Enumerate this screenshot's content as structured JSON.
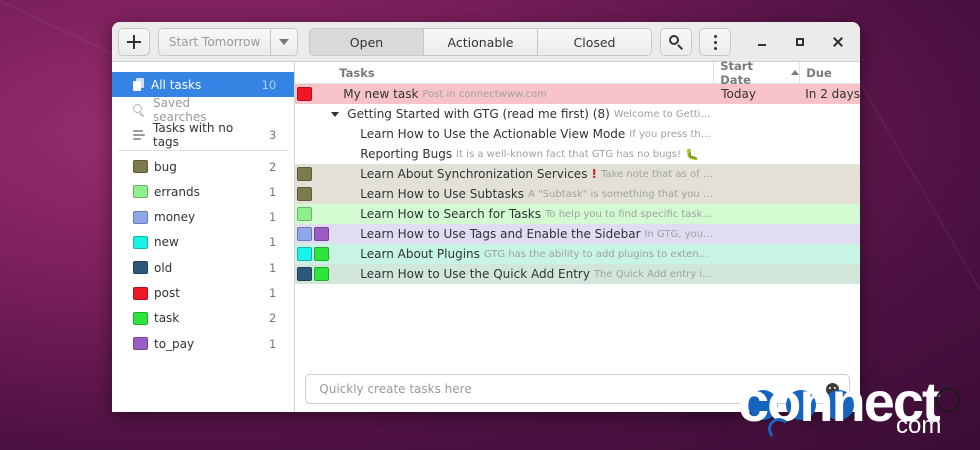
{
  "colors": {
    "accent": "#3584e4",
    "headerbar": "#ebebeb"
  },
  "header": {
    "add_icon": "plus-icon",
    "start_combo": {
      "placeholder": "Start Tomorrow"
    },
    "views": [
      {
        "label": "Open",
        "active": true
      },
      {
        "label": "Actionable",
        "active": false
      },
      {
        "label": "Closed",
        "active": false
      }
    ],
    "search_icon": "search-icon",
    "menu_icon": "kebab-menu-icon"
  },
  "sidebar": {
    "special": [
      {
        "label": "All tasks",
        "count": "10",
        "icon": "all-tasks-icon",
        "selected": true
      },
      {
        "label": "Saved searches",
        "count": "",
        "icon": "search-icon",
        "selected": false
      },
      {
        "label": "Tasks with no tags",
        "count": "3",
        "icon": "no-tags-icon",
        "selected": false
      }
    ],
    "tags": [
      {
        "label": "bug",
        "count": "2",
        "color": "#7b7b4d"
      },
      {
        "label": "errands",
        "count": "1",
        "color": "#8ef08c"
      },
      {
        "label": "money",
        "count": "1",
        "color": "#8fa6e8"
      },
      {
        "label": "new",
        "count": "1",
        "color": "#19f3e6"
      },
      {
        "label": "old",
        "count": "1",
        "color": "#2b587b"
      },
      {
        "label": "post",
        "count": "1",
        "color": "#f01626"
      },
      {
        "label": "task",
        "count": "2",
        "color": "#2ee53d"
      },
      {
        "label": "to_pay",
        "count": "1",
        "color": "#9c5cc6"
      }
    ]
  },
  "columns": {
    "tasks": "Tasks",
    "start": "Start Date",
    "due": "Due"
  },
  "tasks": [
    {
      "title": "My new task",
      "excerpt": "Post in connectwww.com",
      "start": "Today",
      "due": "In 2 days",
      "indent": 1,
      "bg": "#f7c3c8",
      "swatches": [
        "#f01626"
      ]
    },
    {
      "title": "Getting Started with GTG (read me first) (8)",
      "excerpt": "Welcome to Getting Thin...",
      "start": "",
      "due": "",
      "indent": 0,
      "bg": "#ffffff",
      "swatches": [],
      "expander": true
    },
    {
      "title": "Learn How to Use the Actionable View Mode",
      "excerpt": "If you press the \"Acti...",
      "start": "",
      "due": "",
      "indent": 2,
      "bg": "#ffffff",
      "swatches": []
    },
    {
      "title": "Reporting Bugs",
      "excerpt": "It is a well-known fact that GTG has no bugs!",
      "start": "",
      "due": "",
      "indent": 2,
      "bg": "#ffffff",
      "swatches": [],
      "bug": "🐛"
    },
    {
      "title": "Learn About Synchronization Services",
      "excerpt": "Take note that as of GTG...",
      "start": "",
      "due": "",
      "indent": 2,
      "bg": "#e3e1d7",
      "swatches": [
        "#7b7b4d"
      ],
      "warn": "!"
    },
    {
      "title": "Learn How to Use Subtasks",
      "excerpt": "A \"Subtask\" is something that you need ...",
      "start": "",
      "due": "",
      "indent": 2,
      "bg": "#e3e1d7",
      "swatches": [
        "#7b7b4d"
      ]
    },
    {
      "title": "Learn How to Search for Tasks",
      "excerpt": "To help you to find specific tasks mo...",
      "start": "",
      "due": "",
      "indent": 2,
      "bg": "#d3fbd2",
      "swatches": [
        "#8ef08c"
      ]
    },
    {
      "title": "Learn How to Use Tags and Enable the Sidebar",
      "excerpt": "In GTG, you use t...",
      "start": "",
      "due": "",
      "indent": 2,
      "bg": "#e0dcf1",
      "swatches": [
        "#8fa6e8",
        "#9c5cc6"
      ]
    },
    {
      "title": "Learn About Plugins",
      "excerpt": "GTG has the ability to add plugins to extend its c...",
      "start": "",
      "due": "",
      "indent": 2,
      "bg": "#c8f5e3",
      "swatches": [
        "#19f3e6",
        "#2ee53d"
      ]
    },
    {
      "title": "Learn How to Use the Quick Add Entry",
      "excerpt": "The Quick Add entry is the f...",
      "start": "",
      "due": "",
      "indent": 2,
      "bg": "#d2e7da",
      "swatches": [
        "#2b587b",
        "#2ee53d"
      ]
    }
  ],
  "quick_add": {
    "placeholder": "Quickly create tasks here",
    "emoji_icon": "emoji-icon"
  },
  "watermark": {
    "text": "connect",
    "sub": "com"
  }
}
